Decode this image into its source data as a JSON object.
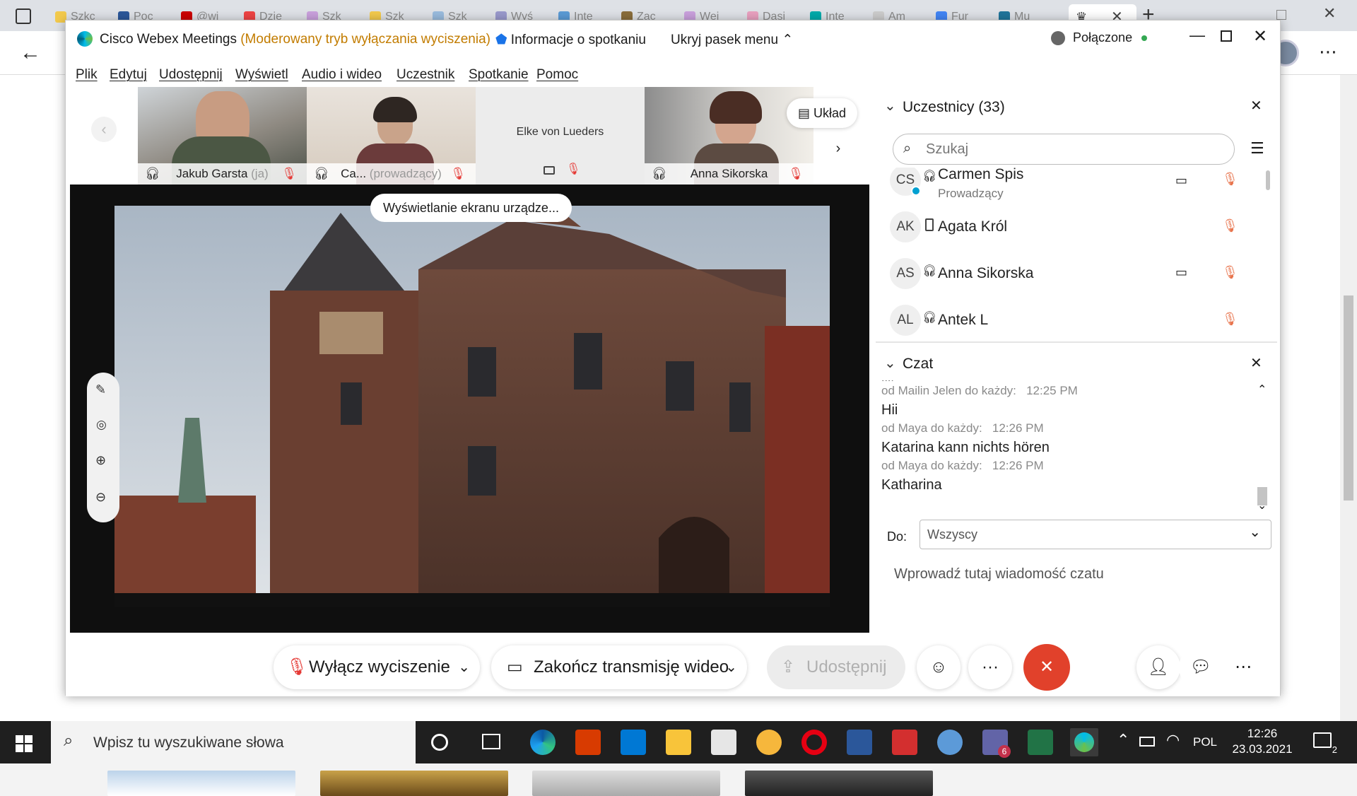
{
  "browser": {
    "tabs": [
      "Szkc",
      "Poc",
      "@wi",
      "Dzie",
      "Szk",
      "Szk",
      "Szk",
      "Wyś",
      "Inte",
      "Zac",
      "Wei",
      "Dasi",
      "Inte",
      "Am",
      "Fur",
      "Mu"
    ],
    "tab_colors": [
      "#f2c94c",
      "#2b579a",
      "#c00",
      "#e44",
      "#c9a0dc",
      "#f2c94c",
      "#9bd",
      "#99c",
      "#5b9bd5",
      "#8a6d3b",
      "#c9a0dc",
      "#e8a0bf",
      "#0aa",
      "#ccc",
      "#4285f4",
      "#21759b"
    ],
    "new_tab": "+"
  },
  "webex": {
    "app_name": "Cisco Webex Meetings",
    "mode": "(Moderowany tryb wyłączania wyciszenia)",
    "meeting_info": "Informacje o spotkaniu",
    "hide_menu": "Ukryj pasek menu",
    "connection": "Połączone",
    "menu": [
      "Plik",
      "Edytuj",
      "Udostępnij",
      "Wyświetl",
      "Audio i wideo",
      "Uczestnik",
      "Spotkanie",
      "Pomoc"
    ],
    "layout_button": "Układ",
    "tiles": [
      {
        "name": "Jakub Garsta",
        "tag": "(ja)"
      },
      {
        "name": "Ca...",
        "tag": "(prowadzący)"
      },
      {
        "name": "Elke von Lueders",
        "tag": ""
      },
      {
        "name": "Anna Sikorska",
        "tag": ""
      }
    ],
    "share_banner": "Wyświetlanie ekranu urządze...",
    "participants": {
      "title": "Uczestnicy (33)",
      "search_placeholder": "Szukaj",
      "items": [
        {
          "initials": "CS",
          "name": "Carmen Spis",
          "role": "Prowadzący"
        },
        {
          "initials": "AK",
          "name": "Agata Król",
          "role": ""
        },
        {
          "initials": "AS",
          "name": "Anna Sikorska",
          "role": ""
        },
        {
          "initials": "AL",
          "name": "Antek L",
          "role": ""
        }
      ]
    },
    "chat": {
      "title": "Czat",
      "partial": "...,",
      "messages": [
        {
          "meta": "od Mailin Jelen do każdy:",
          "time": "12:25 PM",
          "text": "Hii"
        },
        {
          "meta": "od Maya do każdy:",
          "time": "12:26 PM",
          "text": "Katarina kann nichts hören"
        },
        {
          "meta": "od Maya do każdy:",
          "time": "12:26 PM",
          "text": "Katharina"
        }
      ],
      "to_label": "Do:",
      "to_value": "Wszyscy",
      "input_placeholder": "Wprowadź tutaj wiadomość czatu"
    },
    "controls": {
      "unmute": "Wyłącz wyciszenie",
      "stop_video": "Zakończ transmisję wideo",
      "share": "Udostępnij",
      "more": "···"
    }
  },
  "taskbar": {
    "search_placeholder": "Wpisz tu wyszukiwane słowa",
    "lang": "POL",
    "time": "12:26",
    "date": "23.03.2021",
    "notif_count": "2",
    "teams_badge": "6"
  }
}
